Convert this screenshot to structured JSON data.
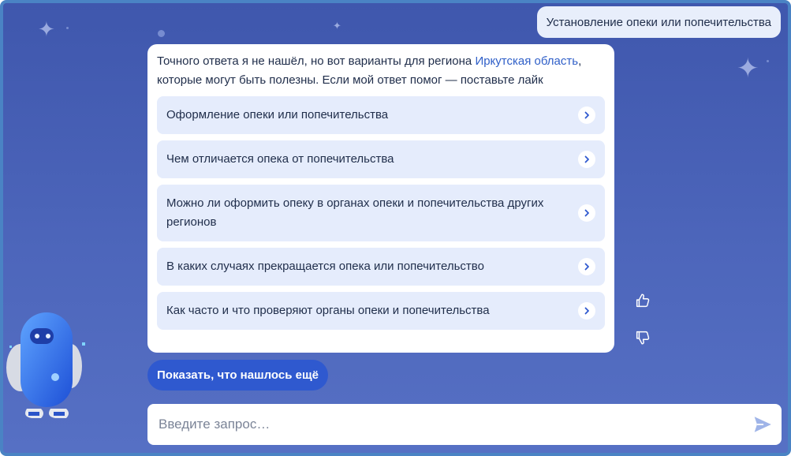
{
  "chat": {
    "user_message": "Установление опеки или попечительства",
    "bot": {
      "text_before_link": "Точного ответа я не нашёл, но вот варианты для региона ",
      "region_link": "Иркутская область",
      "text_after_link": ", которые могут быть полезны. Если мой ответ помог — поставьте лайк",
      "options": [
        {
          "label": "Оформление опеки или попечительства"
        },
        {
          "label": "Чем отличается опека от попечительства"
        },
        {
          "label": "Можно ли оформить опеку в органах опеки и попечительства других регионов"
        },
        {
          "label": "В каких случаях прекращается опека или попечительство"
        },
        {
          "label": "Как часто и что проверяют органы опеки и попечительства"
        }
      ]
    },
    "show_more_label": "Показать, что нашлось ещё"
  },
  "input": {
    "placeholder": "Введите запрос…",
    "value": ""
  },
  "icons": {
    "like": "thumbs-up-icon",
    "dislike": "thumbs-down-icon",
    "send": "send-icon",
    "option_arrow": "chevron-right-icon"
  },
  "colors": {
    "background": "#4a63b8",
    "accent": "#2f59cf",
    "option_bg": "#e5ecfc",
    "link": "#2f5fc8"
  }
}
